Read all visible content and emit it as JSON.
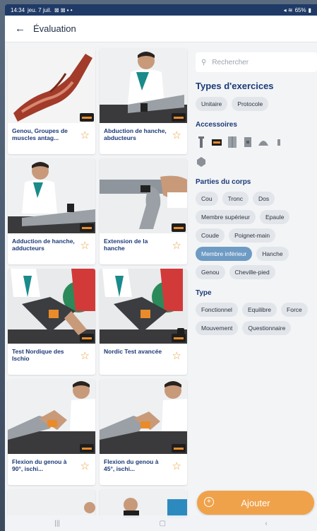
{
  "status": {
    "time": "14:34",
    "date": "jeu. 7 juil.",
    "battery": "65%"
  },
  "appbar": {
    "title": "Évaluation"
  },
  "cards": [
    {
      "caption": "Genou, Groupes de muscles antag..."
    },
    {
      "caption": "Abduction de hanche, abducteurs"
    },
    {
      "caption": "Adduction de hanche, adducteurs"
    },
    {
      "caption": "Extension de la hanche"
    },
    {
      "caption": "Test Nordique des Ischio"
    },
    {
      "caption": "Nordic Test avancée"
    },
    {
      "caption": "Flexion du genou à 90°, ischi..."
    },
    {
      "caption": "Flexion du genou à 45°, ischi..."
    }
  ],
  "filters": {
    "search_placeholder": "Rechercher",
    "types_title": "Types d'exercices",
    "types": [
      "Unitaire",
      "Protocole"
    ],
    "accessoires_title": "Accessoires",
    "parties_title": "Parties du corps",
    "parties": [
      "Cou",
      "Tronc",
      "Dos",
      "Membre supérieur",
      "Epaule",
      "Coude",
      "Poignet-main",
      "Membre inférieur",
      "Hanche",
      "Genou",
      "Cheville-pied"
    ],
    "active_partie": "Membre inférieur",
    "type_title": "Type",
    "type_items": [
      "Fonctionnel",
      "Equilibre",
      "Force",
      "Mouvement",
      "Questionnaire"
    ]
  },
  "add_button": {
    "label": "Ajouter"
  },
  "colors": {
    "primary": "#1d3a78",
    "accent": "#f0a24a",
    "chip_active": "#6e9bc4",
    "star": "#e6a23c"
  }
}
